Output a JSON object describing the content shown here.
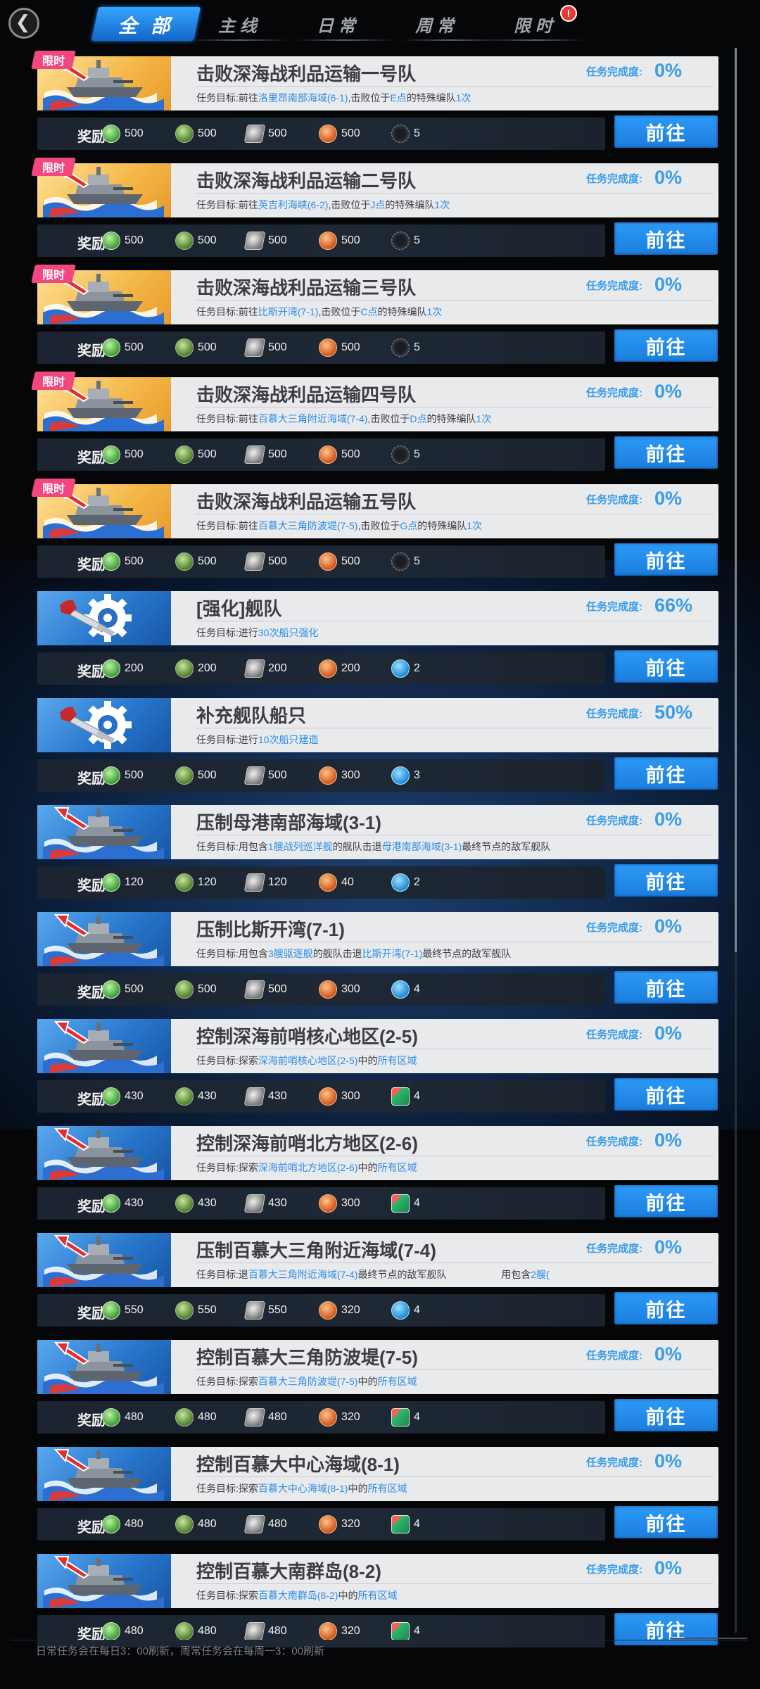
{
  "nav": {
    "back_icon": "chevron-left-icon",
    "tabs": [
      {
        "label": "全 部",
        "active": true
      },
      {
        "label": "主 线",
        "active": false
      },
      {
        "label": "日 常",
        "active": false
      },
      {
        "label": "周 常",
        "active": false
      },
      {
        "label": "限 时",
        "active": false,
        "badge": "!"
      }
    ]
  },
  "labels": {
    "limited_tag": "限时",
    "progress": "任务完成度:",
    "reward": "奖励",
    "go": "前往"
  },
  "tasks": [
    {
      "event": true,
      "image": "battleship-icon",
      "title": "击败深海战利品运输一号队",
      "desc": [
        {
          "t": "任务目标:前往"
        },
        {
          "t": "洛里昂南部海域(6-1)",
          "hl": true
        },
        {
          "t": ",击败位于"
        },
        {
          "t": "E点",
          "hl": true
        },
        {
          "t": "的特殊编队"
        },
        {
          "t": "1次",
          "hl": true
        }
      ],
      "progress": "0%",
      "rewards": [
        {
          "icon": "fuel",
          "value": "500"
        },
        {
          "icon": "ammo",
          "value": "500"
        },
        {
          "icon": "steel",
          "value": "500"
        },
        {
          "icon": "alum",
          "value": "500"
        },
        {
          "icon": "core",
          "value": "5"
        }
      ]
    },
    {
      "event": true,
      "image": "battleship-icon",
      "title": "击败深海战利品运输二号队",
      "desc": [
        {
          "t": "任务目标:前往"
        },
        {
          "t": "英吉利海峡(6-2)",
          "hl": true
        },
        {
          "t": ",击败位于"
        },
        {
          "t": "J点",
          "hl": true
        },
        {
          "t": "的特殊编队"
        },
        {
          "t": "1次",
          "hl": true
        }
      ],
      "progress": "0%",
      "rewards": [
        {
          "icon": "fuel",
          "value": "500"
        },
        {
          "icon": "ammo",
          "value": "500"
        },
        {
          "icon": "steel",
          "value": "500"
        },
        {
          "icon": "alum",
          "value": "500"
        },
        {
          "icon": "core",
          "value": "5"
        }
      ]
    },
    {
      "event": true,
      "image": "battleship-icon",
      "title": "击败深海战利品运输三号队",
      "desc": [
        {
          "t": "任务目标:前往"
        },
        {
          "t": "比斯开湾(7-1)",
          "hl": true
        },
        {
          "t": ",击败位于"
        },
        {
          "t": "C点",
          "hl": true
        },
        {
          "t": "的特殊编队"
        },
        {
          "t": "1次",
          "hl": true
        }
      ],
      "progress": "0%",
      "rewards": [
        {
          "icon": "fuel",
          "value": "500"
        },
        {
          "icon": "ammo",
          "value": "500"
        },
        {
          "icon": "steel",
          "value": "500"
        },
        {
          "icon": "alum",
          "value": "500"
        },
        {
          "icon": "core",
          "value": "5"
        }
      ]
    },
    {
      "event": true,
      "image": "battleship-icon",
      "title": "击败深海战利品运输四号队",
      "desc": [
        {
          "t": "任务目标:前往"
        },
        {
          "t": "百慕大三角附近海域(7-4)",
          "hl": true
        },
        {
          "t": ",击败位于"
        },
        {
          "t": "D点",
          "hl": true
        },
        {
          "t": "的特殊编队"
        },
        {
          "t": "1次",
          "hl": true
        }
      ],
      "progress": "0%",
      "rewards": [
        {
          "icon": "fuel",
          "value": "500"
        },
        {
          "icon": "ammo",
          "value": "500"
        },
        {
          "icon": "steel",
          "value": "500"
        },
        {
          "icon": "alum",
          "value": "500"
        },
        {
          "icon": "core",
          "value": "5"
        }
      ]
    },
    {
      "event": true,
      "image": "battleship-icon",
      "title": "击败深海战利品运输五号队",
      "desc": [
        {
          "t": "任务目标:前往"
        },
        {
          "t": "百慕大三角防波堤(7-5)",
          "hl": true
        },
        {
          "t": ",击败位于"
        },
        {
          "t": "G点",
          "hl": true
        },
        {
          "t": "的特殊编队"
        },
        {
          "t": "1次",
          "hl": true
        }
      ],
      "progress": "0%",
      "rewards": [
        {
          "icon": "fuel",
          "value": "500"
        },
        {
          "icon": "ammo",
          "value": "500"
        },
        {
          "icon": "steel",
          "value": "500"
        },
        {
          "icon": "alum",
          "value": "500"
        },
        {
          "icon": "core",
          "value": "5"
        }
      ]
    },
    {
      "event": false,
      "image": "wrench-gear-icon",
      "title": "[强化]舰队",
      "desc": [
        {
          "t": "任务目标:进行"
        },
        {
          "t": "30次船只强化",
          "hl": true
        }
      ],
      "progress": "66%",
      "rewards": [
        {
          "icon": "fuel",
          "value": "200"
        },
        {
          "icon": "ammo",
          "value": "200"
        },
        {
          "icon": "steel",
          "value": "200"
        },
        {
          "icon": "alum",
          "value": "200"
        },
        {
          "icon": "boost",
          "value": "2"
        }
      ]
    },
    {
      "event": false,
      "image": "wrench-gear-icon",
      "title": "补充舰队船只",
      "desc": [
        {
          "t": "任务目标:进行"
        },
        {
          "t": "10次船只建造",
          "hl": true
        }
      ],
      "progress": "50%",
      "rewards": [
        {
          "icon": "fuel",
          "value": "500"
        },
        {
          "icon": "ammo",
          "value": "500"
        },
        {
          "icon": "steel",
          "value": "500"
        },
        {
          "icon": "alum",
          "value": "300"
        },
        {
          "icon": "boost",
          "value": "3"
        }
      ]
    },
    {
      "event": false,
      "image": "battleship-icon",
      "title": "压制母港南部海域(3-1)",
      "desc": [
        {
          "t": "任务目标:用包含"
        },
        {
          "t": "1艘战列巡洋舰",
          "hl": true
        },
        {
          "t": "的舰队击退"
        },
        {
          "t": "母港南部海域(3-1)",
          "hl": true
        },
        {
          "t": "最终节点的敌军舰队"
        }
      ],
      "progress": "0%",
      "rewards": [
        {
          "icon": "fuel",
          "value": "120"
        },
        {
          "icon": "ammo",
          "value": "120"
        },
        {
          "icon": "steel",
          "value": "120"
        },
        {
          "icon": "alum",
          "value": "40"
        },
        {
          "icon": "boost",
          "value": "2"
        }
      ]
    },
    {
      "event": false,
      "image": "battleship-icon",
      "title": "压制比斯开湾(7-1)",
      "desc": [
        {
          "t": "任务目标:用包含"
        },
        {
          "t": "3艘驱逐舰",
          "hl": true
        },
        {
          "t": "的舰队击退"
        },
        {
          "t": "比斯开湾(7-1)",
          "hl": true
        },
        {
          "t": "最终节点的敌军舰队"
        }
      ],
      "progress": "0%",
      "rewards": [
        {
          "icon": "fuel",
          "value": "500"
        },
        {
          "icon": "ammo",
          "value": "500"
        },
        {
          "icon": "steel",
          "value": "500"
        },
        {
          "icon": "alum",
          "value": "300"
        },
        {
          "icon": "boost",
          "value": "4"
        }
      ]
    },
    {
      "event": false,
      "image": "battleship-icon",
      "title": "控制深海前哨核心地区(2-5)",
      "desc": [
        {
          "t": "任务目标:探索"
        },
        {
          "t": "深海前哨核心地区(2-5)",
          "hl": true
        },
        {
          "t": "中的"
        },
        {
          "t": "所有区域",
          "hl": true
        }
      ],
      "progress": "0%",
      "rewards": [
        {
          "icon": "fuel",
          "value": "430"
        },
        {
          "icon": "ammo",
          "value": "430"
        },
        {
          "icon": "steel",
          "value": "430"
        },
        {
          "icon": "alum",
          "value": "300"
        },
        {
          "icon": "mat",
          "value": "4"
        }
      ]
    },
    {
      "event": false,
      "image": "battleship-icon",
      "title": "控制深海前哨北方地区(2-6)",
      "desc": [
        {
          "t": "任务目标:探索"
        },
        {
          "t": "深海前哨北方地区(2-6)",
          "hl": true
        },
        {
          "t": "中的"
        },
        {
          "t": "所有区域",
          "hl": true
        }
      ],
      "progress": "0%",
      "rewards": [
        {
          "icon": "fuel",
          "value": "430"
        },
        {
          "icon": "ammo",
          "value": "430"
        },
        {
          "icon": "steel",
          "value": "430"
        },
        {
          "icon": "alum",
          "value": "300"
        },
        {
          "icon": "mat",
          "value": "4"
        }
      ]
    },
    {
      "event": false,
      "image": "battleship-icon",
      "title": "压制百慕大三角附近海域(7-4)",
      "desc": [
        {
          "t": "任务目标:退"
        },
        {
          "t": "百慕大三角附近海域(7-4)",
          "hl": true
        },
        {
          "t": "最终节点的敌军舰队                    用包含"
        },
        {
          "t": "2艘(",
          "hl": true
        }
      ],
      "progress": "0%",
      "rewards": [
        {
          "icon": "fuel",
          "value": "550"
        },
        {
          "icon": "ammo",
          "value": "550"
        },
        {
          "icon": "steel",
          "value": "550"
        },
        {
          "icon": "alum",
          "value": "320"
        },
        {
          "icon": "boost",
          "value": "4"
        }
      ]
    },
    {
      "event": false,
      "image": "battleship-icon",
      "title": "控制百慕大三角防波堤(7-5)",
      "desc": [
        {
          "t": "任务目标:探索"
        },
        {
          "t": "百慕大三角防波堤(7-5)",
          "hl": true
        },
        {
          "t": "中的"
        },
        {
          "t": "所有区域",
          "hl": true
        }
      ],
      "progress": "0%",
      "rewards": [
        {
          "icon": "fuel",
          "value": "480"
        },
        {
          "icon": "ammo",
          "value": "480"
        },
        {
          "icon": "steel",
          "value": "480"
        },
        {
          "icon": "alum",
          "value": "320"
        },
        {
          "icon": "mat",
          "value": "4"
        }
      ]
    },
    {
      "event": false,
      "image": "battleship-icon",
      "title": "控制百慕大中心海域(8-1)",
      "desc": [
        {
          "t": "任务目标:探索"
        },
        {
          "t": "百慕大中心海域(8-1)",
          "hl": true
        },
        {
          "t": "中的"
        },
        {
          "t": "所有区域",
          "hl": true
        }
      ],
      "progress": "0%",
      "rewards": [
        {
          "icon": "fuel",
          "value": "480"
        },
        {
          "icon": "ammo",
          "value": "480"
        },
        {
          "icon": "steel",
          "value": "480"
        },
        {
          "icon": "alum",
          "value": "320"
        },
        {
          "icon": "mat",
          "value": "4"
        }
      ]
    },
    {
      "event": false,
      "image": "battleship-icon",
      "title": "控制百慕大南群岛(8-2)",
      "desc": [
        {
          "t": "任务目标:探索"
        },
        {
          "t": "百慕大南群岛(8-2)",
          "hl": true
        },
        {
          "t": "中的"
        },
        {
          "t": "所有区域",
          "hl": true
        }
      ],
      "progress": "0%",
      "rewards": [
        {
          "icon": "fuel",
          "value": "480"
        },
        {
          "icon": "ammo",
          "value": "480"
        },
        {
          "icon": "steel",
          "value": "480"
        },
        {
          "icon": "alum",
          "value": "320"
        },
        {
          "icon": "mat",
          "value": "4"
        }
      ]
    }
  ],
  "footer": {
    "note": "日常任务会在每日3：00刷新，周常任务会在每周一3：00刷新"
  },
  "colors": {
    "accent": "#2b8de8",
    "limited_tag": "#f2467f",
    "badge": "#e83a2e"
  }
}
